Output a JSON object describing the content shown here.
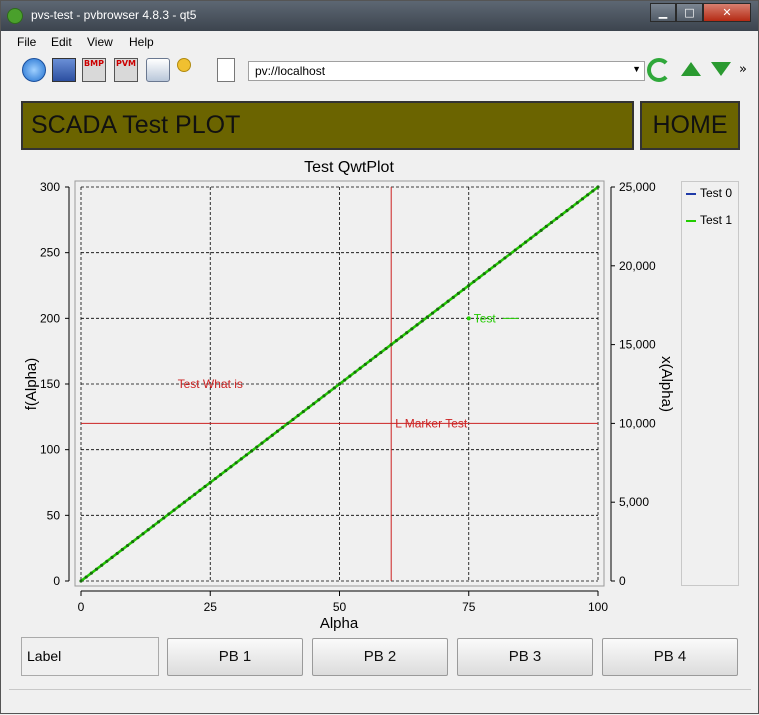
{
  "window": {
    "title": "pvs-test - pvbrowser 4.8.3 - qt5",
    "buttons": {
      "minimize": "▁",
      "maximize": "□",
      "close": "✕"
    }
  },
  "menu": [
    "File",
    "Edit",
    "View",
    "Help"
  ],
  "toolbar": {
    "url": "pv://localhost",
    "icons": [
      "home-icon",
      "screenshot-icon",
      "bmp-export-icon",
      "pvm-export-icon",
      "print-icon",
      "gear-icon",
      "copy-icon",
      "reload-icon",
      "up-arrow-icon",
      "down-arrow-icon"
    ],
    "bmp_label": "BMP",
    "pvm_label": "PVM",
    "more": "»"
  },
  "banner": {
    "title": "SCADA Test  PLOT",
    "home": "HOME"
  },
  "chart_data": {
    "type": "line",
    "title": "Test QwtPlot",
    "xlabel": "Alpha",
    "ylabel": "f(Alpha)",
    "y2label": "x(Alpha)",
    "xlim": [
      0,
      100
    ],
    "ylim": [
      0,
      300
    ],
    "y2lim": [
      0,
      25000
    ],
    "xticks": [
      "0",
      "25",
      "50",
      "75",
      "100"
    ],
    "yticks": [
      "0",
      "50",
      "100",
      "150",
      "200",
      "250",
      "300"
    ],
    "y2ticks": [
      "0",
      "5,000",
      "10,000",
      "15,000",
      "20,000",
      "25,000"
    ],
    "grid": true,
    "legend": [
      "Test 0",
      "Test 1"
    ],
    "series": [
      {
        "name": "Test 0",
        "color": "#1f3aa8",
        "x": [
          0,
          100
        ],
        "y": [
          0,
          300
        ]
      },
      {
        "name": "Test 1",
        "color": "#22cc00",
        "x": [
          0,
          100
        ],
        "y": [
          0,
          300
        ]
      }
    ],
    "markers": [
      {
        "type": "vline",
        "x": 60,
        "color": "#cc2222"
      },
      {
        "type": "hline",
        "y": 120,
        "label": "L Marker Test",
        "color": "#cc2222"
      },
      {
        "type": "text",
        "x": 25,
        "y": 150,
        "label": "Test What is",
        "color": "#cc2222"
      },
      {
        "type": "point",
        "x": 75,
        "y": 200,
        "label": "Test",
        "color": "#22cc00"
      }
    ]
  },
  "bottom": {
    "label": "Label",
    "buttons": [
      "PB 1",
      "PB 2",
      "PB 3",
      "PB 4"
    ]
  },
  "colors": {
    "banner_bg": "#6b6400",
    "grid": "#000000",
    "marker": "#cc2222",
    "series1": "#22cc00"
  }
}
